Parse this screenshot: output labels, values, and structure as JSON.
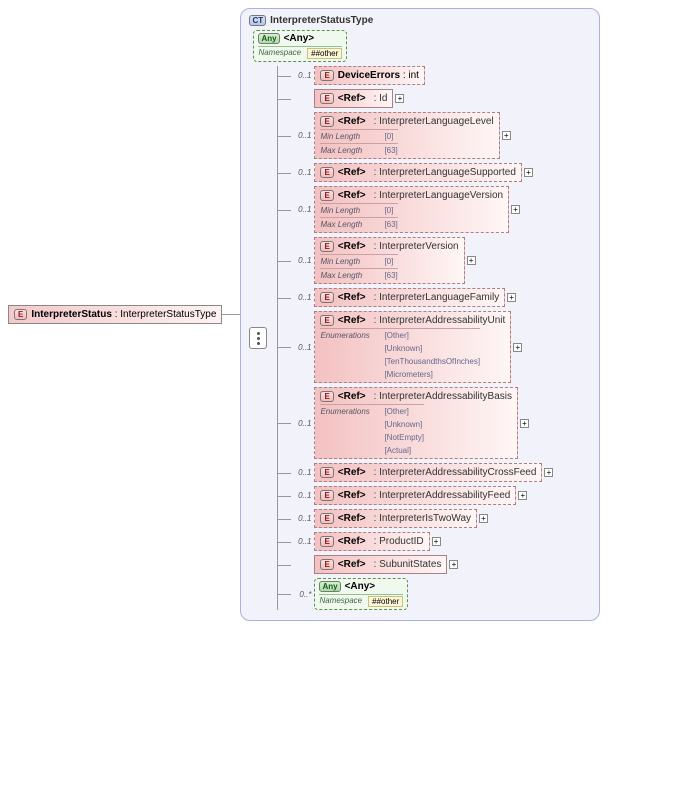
{
  "root": {
    "badge": "E",
    "name": "InterpreterStatus",
    "type": "InterpreterStatusType"
  },
  "ct": {
    "badge": "CT",
    "title": "InterpreterStatusType"
  },
  "topAny": {
    "badge": "Any",
    "label": "<Any>",
    "nsLabel": "Namespace",
    "nsValue": "##other"
  },
  "labels": {
    "ref": "<Ref>",
    "minLen": "Min Length",
    "maxLen": "Max Length",
    "enum": "Enumerations"
  },
  "children": [
    {
      "occ": "0..1",
      "dashed": true,
      "kind": "elem",
      "name": "DeviceErrors",
      "type": "int",
      "expand": false
    },
    {
      "occ": "",
      "dashed": false,
      "kind": "ref",
      "type": "Id",
      "expand": true
    },
    {
      "occ": "0..1",
      "dashed": true,
      "kind": "ref",
      "type": "InterpreterLanguageLevel",
      "expand": true,
      "constraints": [
        [
          "Min Length",
          "[0]"
        ],
        [
          "Max Length",
          "[63]"
        ]
      ]
    },
    {
      "occ": "0..1",
      "dashed": true,
      "kind": "ref",
      "type": "InterpreterLanguageSupported",
      "expand": true
    },
    {
      "occ": "0..1",
      "dashed": true,
      "kind": "ref",
      "type": "InterpreterLanguageVersion",
      "expand": true,
      "constraints": [
        [
          "Min Length",
          "[0]"
        ],
        [
          "Max Length",
          "[63]"
        ]
      ]
    },
    {
      "occ": "0..1",
      "dashed": true,
      "kind": "ref",
      "type": "InterpreterVersion",
      "expand": true,
      "constraints": [
        [
          "Min Length",
          "[0]"
        ],
        [
          "Max Length",
          "[63]"
        ]
      ]
    },
    {
      "occ": "0..1",
      "dashed": true,
      "kind": "ref",
      "type": "InterpreterLanguageFamily",
      "expand": true
    },
    {
      "occ": "0..1",
      "dashed": true,
      "kind": "ref",
      "type": "InterpreterAddressabilityUnit",
      "expand": true,
      "enum": [
        "[Other]",
        "[Unknown]",
        "[TenThousandthsOfInches]",
        "[Micrometers]"
      ]
    },
    {
      "occ": "0..1",
      "dashed": true,
      "kind": "ref",
      "type": "InterpreterAddressabilityBasis",
      "expand": true,
      "enum": [
        "[Other]",
        "[Unknown]",
        "[NotEmpty]",
        "[Actual]"
      ]
    },
    {
      "occ": "0..1",
      "dashed": true,
      "kind": "ref",
      "type": "InterpreterAddressabilityCrossFeed",
      "expand": true
    },
    {
      "occ": "0..1",
      "dashed": true,
      "kind": "ref",
      "type": "InterpreterAddressabilityFeed",
      "expand": true
    },
    {
      "occ": "0..1",
      "dashed": true,
      "kind": "ref",
      "type": "InterpreterIsTwoWay",
      "expand": true
    },
    {
      "occ": "0..1",
      "dashed": true,
      "kind": "ref",
      "type": "ProductID",
      "expand": true
    },
    {
      "occ": "",
      "dashed": false,
      "kind": "ref",
      "type": "SubunitStates",
      "expand": true
    }
  ],
  "bottomAny": {
    "occ": "0..*",
    "badge": "Any",
    "label": "<Any>",
    "nsLabel": "Namespace",
    "nsValue": "##other"
  }
}
